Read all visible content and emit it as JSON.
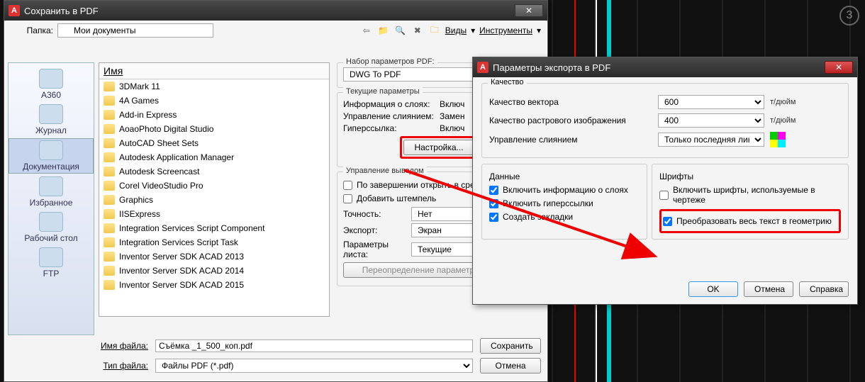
{
  "cad": {
    "viewport_label": "3"
  },
  "save_dialog": {
    "title": "Сохранить в PDF",
    "folder_label": "Папка:",
    "folder_value": "Мои документы",
    "views_label": "Виды",
    "tools_label": "Инструменты",
    "sidebar": [
      {
        "label": "A360"
      },
      {
        "label": "Журнал"
      },
      {
        "label": "Документация",
        "selected": true
      },
      {
        "label": "Избранное"
      },
      {
        "label": "Рабочий стол"
      },
      {
        "label": "FTP"
      }
    ],
    "list_header": "Имя",
    "files": [
      "3DMark 11",
      "4A Games",
      "Add-in Express",
      "AoaoPhoto Digital Studio",
      "AutoCAD Sheet Sets",
      "Autodesk Application Manager",
      "Autodesk Screencast",
      "Corel VideoStudio Pro",
      "Graphics",
      "IISExpress",
      "Integration Services Script Component",
      "Integration Services Script Task",
      "Inventor Server SDK ACAD 2013",
      "Inventor Server SDK ACAD 2014",
      "Inventor Server SDK ACAD 2015"
    ],
    "pdf_params_label": "Набор параметров PDF:",
    "pdf_preset": "DWG To PDF",
    "current_params_label": "Текущие параметры",
    "layer_info_label": "Информация о слоях:",
    "layer_info_value": "Включ",
    "merge_label": "Управление слиянием:",
    "merge_value": "Замен",
    "hyperlink_label": "Гиперссылка:",
    "hyperlink_value": "Включ",
    "settings_btn": "Настройка...",
    "output_label": "Управление выводом",
    "open_after": "По завершении открыть в сред",
    "add_stamp": "Добавить штемпель",
    "precision_label": "Точность:",
    "precision_value": "Нет",
    "export_label": "Экспорт:",
    "export_value": "Экран",
    "sheet_params_label": "Параметры листа:",
    "sheet_params_value": "Текущие",
    "override_btn": "Переопределение параметров листа...",
    "filename_label": "Имя файла:",
    "filename_value": "Съёмка _1_500_коп.pdf",
    "filetype_label": "Тип файла:",
    "filetype_value": "Файлы PDF (*.pdf)",
    "save_btn": "Сохранить",
    "cancel_btn": "Отмена"
  },
  "export_dialog": {
    "title": "Параметры экспорта в PDF",
    "quality_group": "Качество",
    "vector_quality": "Качество вектора",
    "vector_value": "600",
    "raster_quality": "Качество растрового изображения",
    "raster_value": "400",
    "unit": "т/дюйм",
    "merge_control": "Управление слиянием",
    "merge_value": "Только последняя линия",
    "data_group": "Данные",
    "include_layers": "Включить информацию о слоях",
    "include_hyperlinks": "Включить гиперссылки",
    "create_bookmarks": "Создать закладки",
    "fonts_group": "Шрифты",
    "include_fonts": "Включить шрифты, используемые в чертеже",
    "convert_text": "Преобразовать весь текст в геометрию",
    "ok_btn": "OK",
    "cancel_btn": "Отмена",
    "help_btn": "Справка"
  }
}
